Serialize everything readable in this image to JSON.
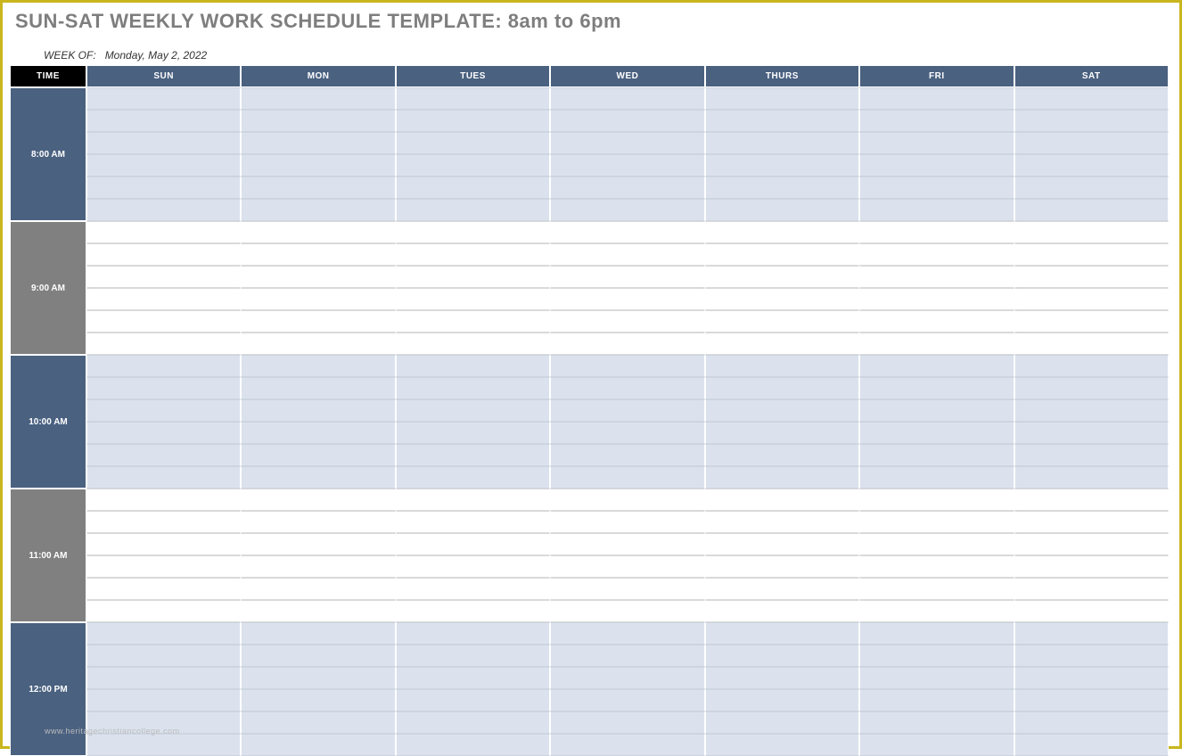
{
  "title": "SUN-SAT WEEKLY WORK SCHEDULE TEMPLATE: 8am to 6pm",
  "weekof_label": "WEEK OF:",
  "weekof_date": "Monday, May 2, 2022",
  "headers": {
    "time": "TIME",
    "days": [
      "SUN",
      "MON",
      "TUES",
      "WED",
      "THURS",
      "FRI",
      "SAT"
    ]
  },
  "time_slots": [
    {
      "label": "8:00 AM",
      "style": "blue",
      "rows": 6
    },
    {
      "label": "9:00 AM",
      "style": "gray",
      "rows": 6
    },
    {
      "label": "10:00 AM",
      "style": "blue",
      "rows": 6
    },
    {
      "label": "11:00 AM",
      "style": "gray",
      "rows": 6
    },
    {
      "label": "12:00 PM",
      "style": "blue",
      "rows": 6
    }
  ],
  "watermark": "www.heritagechristiancollege.com"
}
